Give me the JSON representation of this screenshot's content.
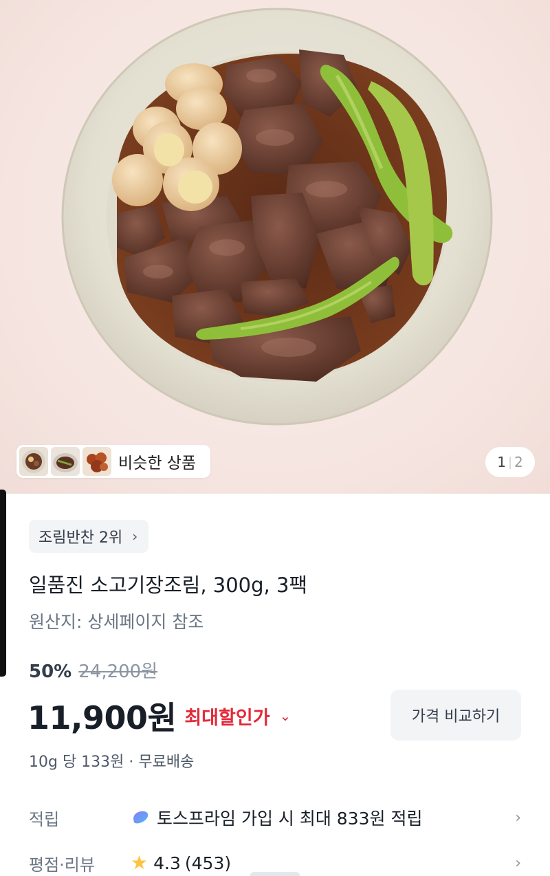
{
  "hero": {
    "similar_label": "비슷한 상품",
    "thumbnail_icons": [
      "beef-stew-thumbnail",
      "braised-dish-thumbnail",
      "spicy-side-dish-thumbnail"
    ],
    "pager_current": "1",
    "pager_total": "2"
  },
  "product": {
    "rank_badge": "조림반찬 2위",
    "title": "일품진 소고기장조림, 300g, 3팩",
    "origin": "원산지: 상세페이지 참조",
    "discount_rate": "50%",
    "original_price": "24,200원",
    "price": "11,900원",
    "max_discount_label": "최대할인가",
    "compare_button": "가격 비교하기",
    "unit_price": "10g 당 133원 · 무료배송"
  },
  "rows": {
    "reward_label": "적립",
    "reward_value": "토스프라임 가입 시 최대 833원 적립",
    "review_label": "평점·리뷰",
    "rating": "4.3",
    "review_count": "(453)"
  },
  "colors": {
    "accent_red": "#e42939",
    "chip_bg": "#f2f4f6",
    "star": "#ffc342",
    "prime_gradient": [
      "#8b7cf6",
      "#4fb6f5"
    ]
  }
}
